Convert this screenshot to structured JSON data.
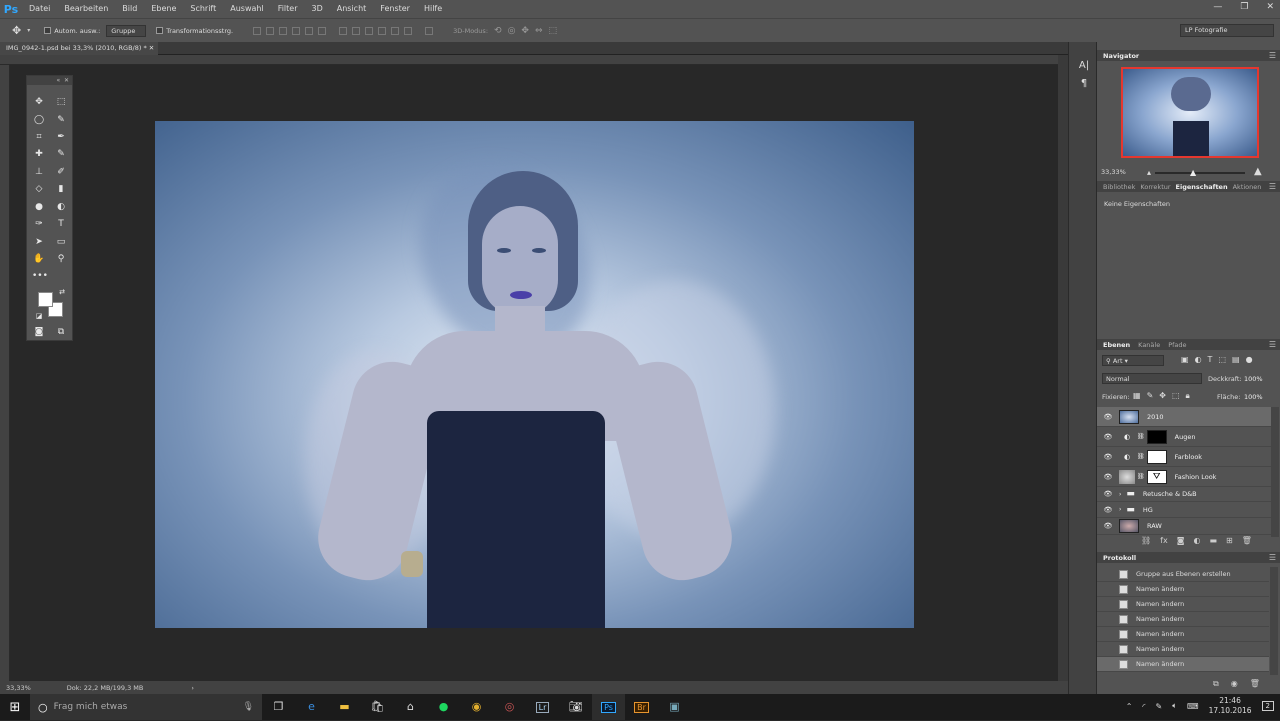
{
  "app": {
    "logo": "Ps"
  },
  "menu": [
    "Datei",
    "Bearbeiten",
    "Bild",
    "Ebene",
    "Schrift",
    "Auswahl",
    "Filter",
    "3D",
    "Ansicht",
    "Fenster",
    "Hilfe"
  ],
  "options": {
    "auto_select_label": "Autom. ausw.:",
    "auto_select_value": "Gruppe",
    "transform_label": "Transformationsstrg.",
    "mode_3d": "3D-Modus:",
    "workspace": "LP Fotografie"
  },
  "document": {
    "tab_title": "IMG_0942-1.psd bei 33,3% (2010, RGB/8) *",
    "zoom": "33,33%",
    "doc_size": "Dok: 22,2 MB/199,3 MB"
  },
  "navigator": {
    "title": "Navigator",
    "zoom": "33,33%"
  },
  "properties": {
    "tabs": [
      "Bibliothek",
      "Korrektur",
      "Eigenschaften",
      "Aktionen"
    ],
    "active_tab": "Eigenschaften",
    "empty_text": "Keine Eigenschaften"
  },
  "layers_panel": {
    "tabs": [
      "Ebenen",
      "Kanäle",
      "Pfade"
    ],
    "filter": "Art",
    "blend_mode": "Normal",
    "opacity_label": "Deckkraft:",
    "opacity": "100%",
    "lock_label": "Fixieren:",
    "fill_label": "Fläche:",
    "fill": "100%",
    "layers": [
      {
        "name": "2010",
        "selected": true,
        "type": "pixel"
      },
      {
        "name": "Augen",
        "selected": false,
        "type": "adjustment-black-mask"
      },
      {
        "name": "Farblook",
        "selected": false,
        "type": "adjustment-white-mask"
      },
      {
        "name": "Fashion Look",
        "selected": false,
        "type": "adjustment-figure-mask"
      },
      {
        "name": "Retusche & D&B",
        "selected": false,
        "type": "group"
      },
      {
        "name": "HG",
        "selected": false,
        "type": "group"
      },
      {
        "name": "RAW",
        "selected": false,
        "type": "pixel"
      }
    ]
  },
  "history": {
    "title": "Protokoll",
    "items": [
      {
        "label": "Gruppe aus Ebenen erstellen",
        "selected": false
      },
      {
        "label": "Namen ändern",
        "selected": false
      },
      {
        "label": "Namen ändern",
        "selected": false
      },
      {
        "label": "Namen ändern",
        "selected": false
      },
      {
        "label": "Namen ändern",
        "selected": false
      },
      {
        "label": "Namen ändern",
        "selected": false
      },
      {
        "label": "Namen ändern",
        "selected": true
      }
    ]
  },
  "taskbar": {
    "search_placeholder": "Frag mich etwas",
    "apps": [
      "edge-icon",
      "explorer-icon",
      "store-icon",
      "home-icon",
      "spotify-icon",
      "chrome-icon",
      "app-icon",
      "lightroom-icon",
      "camera-icon",
      "photoshop-icon",
      "bridge-icon",
      "window-icon"
    ],
    "lr_label": "Lr",
    "ps_label": "Ps",
    "br_label": "Br",
    "time": "21:46",
    "date": "17.10.2016",
    "notifications": "2"
  }
}
